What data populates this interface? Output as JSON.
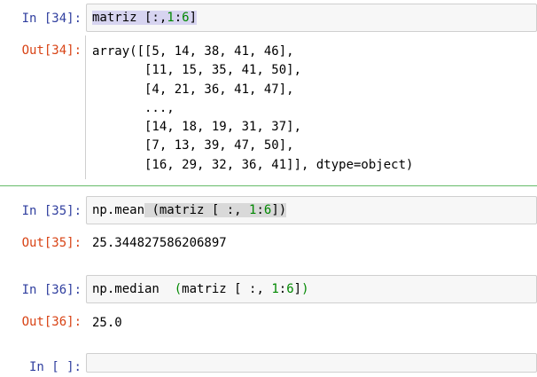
{
  "cells": [
    {
      "in_prompt": "In [34]:",
      "code_tokens": [
        "matriz [:,",
        "1",
        ":",
        "6",
        "]"
      ],
      "out_prompt": "Out[34]:",
      "output_lines": [
        "array([[5, 14, 38, 41, 46],",
        "       [11, 15, 35, 41, 50],",
        "       [4, 21, 36, 41, 47],",
        "       ...,",
        "       [14, 18, 19, 31, 37],",
        "       [7, 13, 39, 47, 50],",
        "       [16, 29, 32, 36, 41]], dtype=object)"
      ]
    },
    {
      "in_prompt": "In [35]:",
      "code_tokens": [
        "np.mean",
        " (matriz [ :, ",
        "1",
        ":",
        "6",
        "])"
      ],
      "out_prompt": "Out[35]:",
      "output": "25.344827586206897"
    },
    {
      "in_prompt": "In [36]:",
      "code_tokens": [
        "np.median  ",
        "(",
        "matriz [ :, ",
        "1",
        ":",
        "6",
        "]",
        ")"
      ],
      "out_prompt": "Out[36]:",
      "output": "25.0"
    },
    {
      "in_prompt": "In [ ]:"
    }
  ]
}
